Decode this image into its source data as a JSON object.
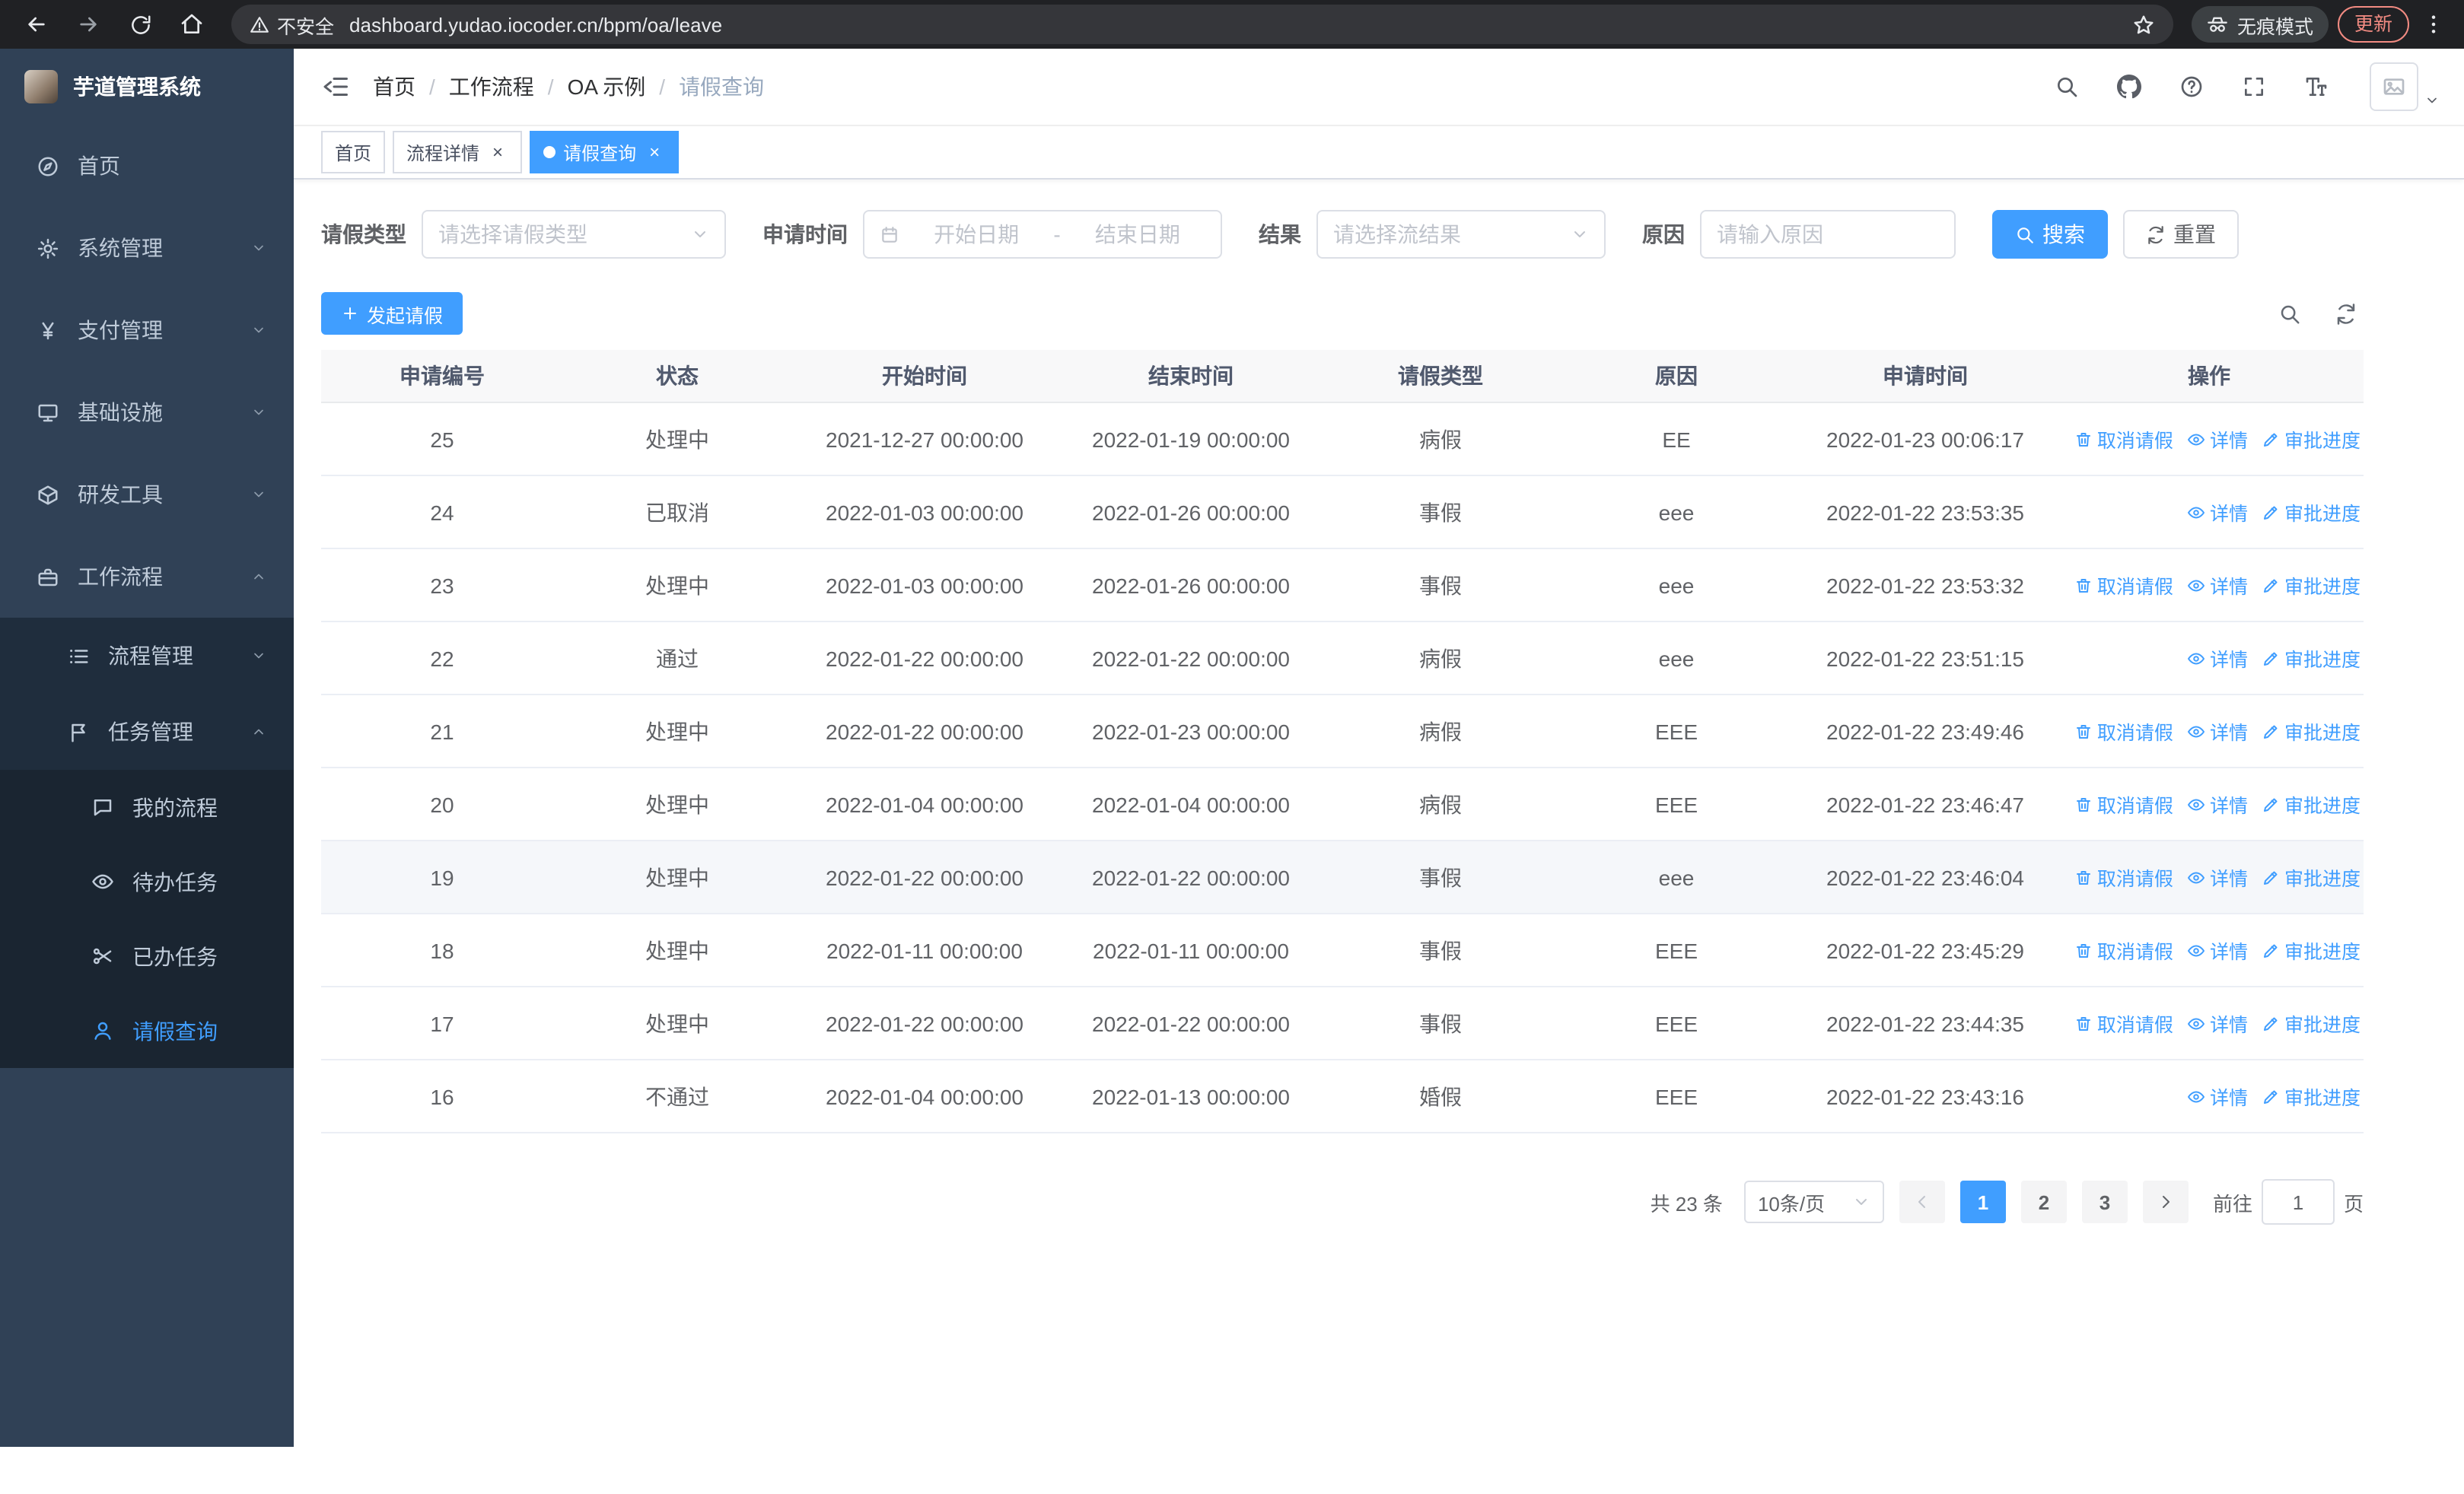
{
  "browser": {
    "security_label": "不安全",
    "url": "dashboard.yudao.iocoder.cn/bpm/oa/leave",
    "incognito_label": "无痕模式",
    "update_label": "更新"
  },
  "sidebar": {
    "app_title": "芋道管理系统",
    "items": [
      {
        "label": "首页",
        "icon": "dashboard-icon"
      },
      {
        "label": "系统管理",
        "icon": "gear-icon"
      },
      {
        "label": "支付管理",
        "icon": "yen-icon"
      },
      {
        "label": "基础设施",
        "icon": "monitor-icon"
      },
      {
        "label": "研发工具",
        "icon": "box-icon"
      },
      {
        "label": "工作流程",
        "icon": "briefcase-icon"
      }
    ],
    "workflow_children": [
      {
        "label": "流程管理",
        "icon": "list-icon"
      },
      {
        "label": "任务管理",
        "icon": "flag-icon"
      }
    ],
    "task_children": [
      {
        "label": "我的流程",
        "icon": "chat-icon"
      },
      {
        "label": "待办任务",
        "icon": "eye-icon"
      },
      {
        "label": "已办任务",
        "icon": "scissors-icon"
      },
      {
        "label": "请假查询",
        "icon": "user-icon"
      }
    ]
  },
  "breadcrumb": [
    "首页",
    "工作流程",
    "OA 示例",
    "请假查询"
  ],
  "tabs": [
    {
      "label": "首页"
    },
    {
      "label": "流程详情"
    },
    {
      "label": "请假查询"
    }
  ],
  "filters": {
    "leave_type_label": "请假类型",
    "leave_type_placeholder": "请选择请假类型",
    "apply_time_label": "申请时间",
    "start_date_placeholder": "开始日期",
    "date_separator": "-",
    "end_date_placeholder": "结束日期",
    "result_label": "结果",
    "result_placeholder": "请选择流结果",
    "reason_label": "原因",
    "reason_placeholder": "请输入原因",
    "search_button": "搜索",
    "reset_button": "重置"
  },
  "toolbar": {
    "create_button": "发起请假"
  },
  "table": {
    "columns": [
      "申请编号",
      "状态",
      "开始时间",
      "结束时间",
      "请假类型",
      "原因",
      "申请时间",
      "操作"
    ],
    "action_labels": {
      "cancel": "取消请假",
      "detail": "详情",
      "progress": "审批进度"
    },
    "rows": [
      {
        "no": "25",
        "status": "处理中",
        "start_time": "2021-12-27 00:00:00",
        "end_time": "2022-01-19 00:00:00",
        "leave_type": "病假",
        "reason": "EE",
        "apply_time": "2022-01-23 00:06:17",
        "actions": [
          "cancel",
          "detail",
          "progress"
        ],
        "highlighted": false
      },
      {
        "no": "24",
        "status": "已取消",
        "start_time": "2022-01-03 00:00:00",
        "end_time": "2022-01-26 00:00:00",
        "leave_type": "事假",
        "reason": "eee",
        "apply_time": "2022-01-22 23:53:35",
        "actions": [
          "detail",
          "progress"
        ],
        "highlighted": false
      },
      {
        "no": "23",
        "status": "处理中",
        "start_time": "2022-01-03 00:00:00",
        "end_time": "2022-01-26 00:00:00",
        "leave_type": "事假",
        "reason": "eee",
        "apply_time": "2022-01-22 23:53:32",
        "actions": [
          "cancel",
          "detail",
          "progress"
        ],
        "highlighted": false
      },
      {
        "no": "22",
        "status": "通过",
        "start_time": "2022-01-22 00:00:00",
        "end_time": "2022-01-22 00:00:00",
        "leave_type": "病假",
        "reason": "eee",
        "apply_time": "2022-01-22 23:51:15",
        "actions": [
          "detail",
          "progress"
        ],
        "highlighted": false
      },
      {
        "no": "21",
        "status": "处理中",
        "start_time": "2022-01-22 00:00:00",
        "end_time": "2022-01-23 00:00:00",
        "leave_type": "病假",
        "reason": "EEE",
        "apply_time": "2022-01-22 23:49:46",
        "actions": [
          "cancel",
          "detail",
          "progress"
        ],
        "highlighted": false
      },
      {
        "no": "20",
        "status": "处理中",
        "start_time": "2022-01-04 00:00:00",
        "end_time": "2022-01-04 00:00:00",
        "leave_type": "病假",
        "reason": "EEE",
        "apply_time": "2022-01-22 23:46:47",
        "actions": [
          "cancel",
          "detail",
          "progress"
        ],
        "highlighted": false
      },
      {
        "no": "19",
        "status": "处理中",
        "start_time": "2022-01-22 00:00:00",
        "end_time": "2022-01-22 00:00:00",
        "leave_type": "事假",
        "reason": "eee",
        "apply_time": "2022-01-22 23:46:04",
        "actions": [
          "cancel",
          "detail",
          "progress"
        ],
        "highlighted": true
      },
      {
        "no": "18",
        "status": "处理中",
        "start_time": "2022-01-11 00:00:00",
        "end_time": "2022-01-11 00:00:00",
        "leave_type": "事假",
        "reason": "EEE",
        "apply_time": "2022-01-22 23:45:29",
        "actions": [
          "cancel",
          "detail",
          "progress"
        ],
        "highlighted": false
      },
      {
        "no": "17",
        "status": "处理中",
        "start_time": "2022-01-22 00:00:00",
        "end_time": "2022-01-22 00:00:00",
        "leave_type": "事假",
        "reason": "EEE",
        "apply_time": "2022-01-22 23:44:35",
        "actions": [
          "cancel",
          "detail",
          "progress"
        ],
        "highlighted": false
      },
      {
        "no": "16",
        "status": "不通过",
        "start_time": "2022-01-04 00:00:00",
        "end_time": "2022-01-13 00:00:00",
        "leave_type": "婚假",
        "reason": "EEE",
        "apply_time": "2022-01-22 23:43:16",
        "actions": [
          "detail",
          "progress"
        ],
        "highlighted": false
      }
    ]
  },
  "pagination": {
    "total_text": "共 23 条",
    "page_size": "10条/页",
    "pages": [
      "1",
      "2",
      "3"
    ],
    "active_page": "1",
    "goto_label": "前往",
    "goto_value": "1",
    "page_unit": "页"
  }
}
